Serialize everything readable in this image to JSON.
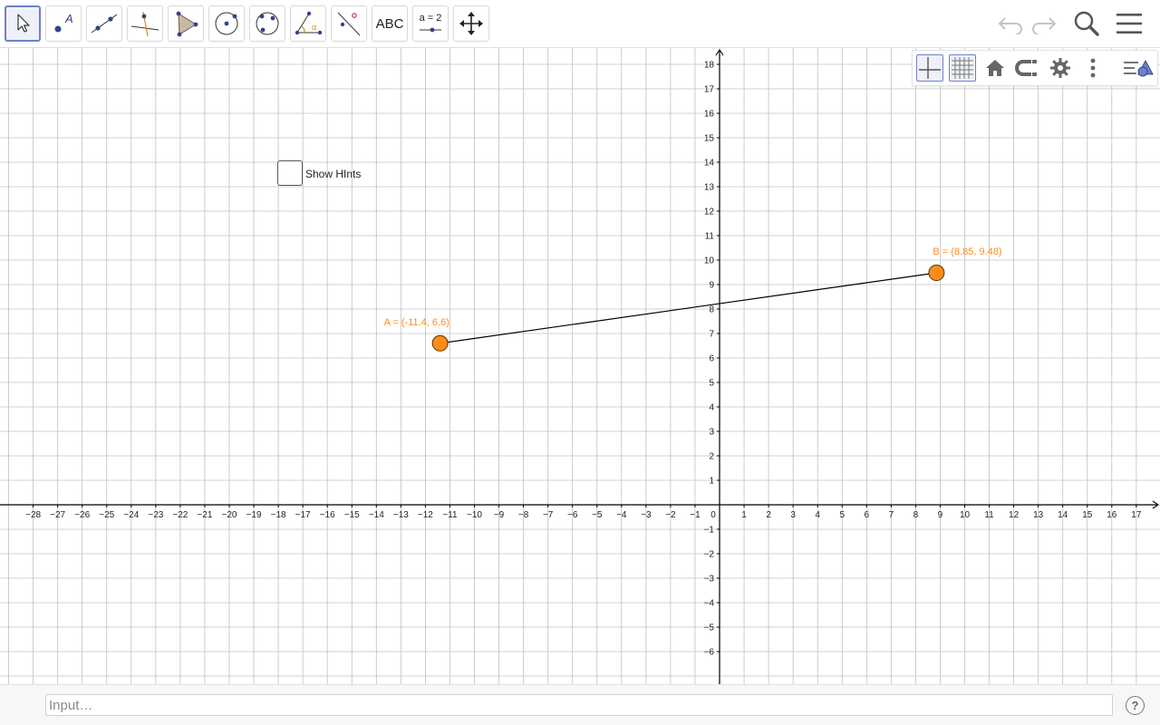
{
  "toolbar": {
    "tools": [
      {
        "name": "move-tool",
        "label": ""
      },
      {
        "name": "point-tool",
        "label": "A"
      },
      {
        "name": "line-tool",
        "label": ""
      },
      {
        "name": "perpendicular-line-tool",
        "label": ""
      },
      {
        "name": "polygon-tool",
        "label": ""
      },
      {
        "name": "circle-center-point-tool",
        "label": ""
      },
      {
        "name": "circle-three-points-tool",
        "label": ""
      },
      {
        "name": "angle-tool",
        "label": "α"
      },
      {
        "name": "reflect-line-tool",
        "label": ""
      },
      {
        "name": "text-tool",
        "label": "ABC"
      },
      {
        "name": "slider-tool",
        "label": "a = 2"
      },
      {
        "name": "move-graphics-view-tool",
        "label": ""
      }
    ],
    "right_icons": [
      "undo-icon",
      "redo-icon",
      "search-icon",
      "menu-icon"
    ]
  },
  "stylebar": {
    "buttons": [
      "axes-toggle-icon",
      "grid-toggle-icon",
      "home-icon",
      "point-capturing-icon",
      "settings-icon",
      "more-icon",
      "toggle-stylebar-icon"
    ]
  },
  "checkbox": {
    "label": "Show HInts",
    "checked": false
  },
  "graph": {
    "axis_color": "#000000",
    "grid_color": "#c0c0c0",
    "x_ticks": [
      -28,
      -27,
      -26,
      -25,
      -24,
      -23,
      -22,
      -21,
      -20,
      -19,
      -18,
      -17,
      -16,
      -15,
      -14,
      -13,
      -12,
      -11,
      -10,
      -9,
      -8,
      -7,
      -6,
      -5,
      -4,
      -3,
      -2,
      -1,
      0,
      1,
      2,
      3,
      4,
      5,
      6,
      7,
      8,
      9,
      10,
      11,
      12,
      13,
      14,
      15,
      16,
      17
    ],
    "y_ticks": [
      -6,
      -5,
      -4,
      -3,
      -2,
      -1,
      1,
      2,
      3,
      4,
      5,
      6,
      7,
      8,
      9,
      10,
      11,
      12,
      13,
      14,
      15,
      16,
      17,
      18
    ],
    "points": [
      {
        "name": "A",
        "x": -11.4,
        "y": 6.6,
        "label": "A = (-11.4, 6.6)",
        "color": "#ff8c1a"
      },
      {
        "name": "B",
        "x": 8.85,
        "y": 9.48,
        "label": "B = (8.85, 9.48)",
        "color": "#ff8c1a"
      }
    ],
    "segment": {
      "from": "A",
      "to": "B",
      "color": "#000000"
    }
  },
  "input_bar": {
    "placeholder": "Input…",
    "help_label": "?"
  }
}
